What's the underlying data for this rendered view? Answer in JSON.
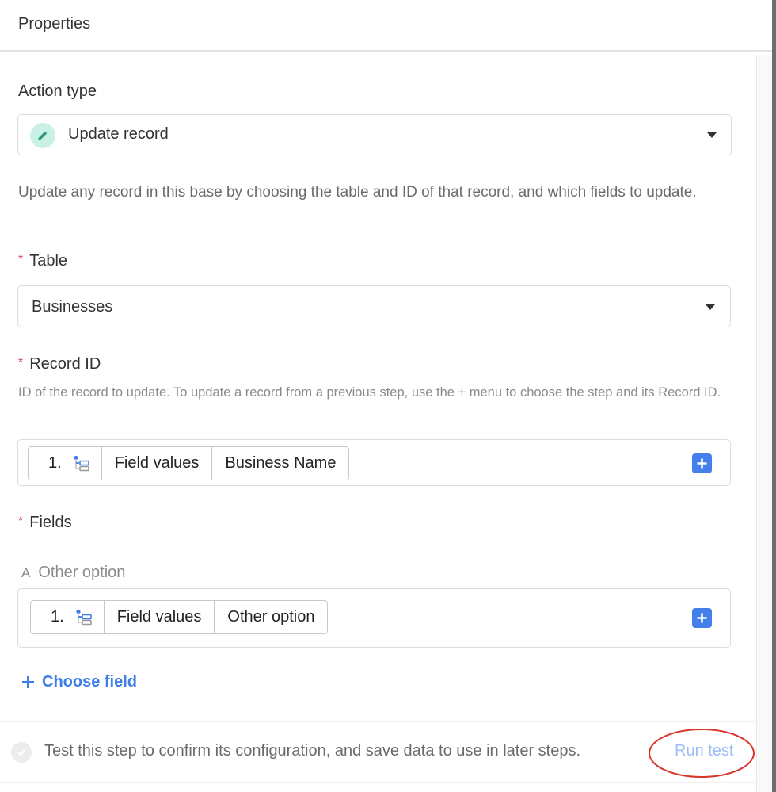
{
  "header": {
    "title": "Properties"
  },
  "action_type": {
    "label": "Action type",
    "selected": "Update record",
    "icon": "pencil-icon",
    "icon_bg_color": "#c9f1e4",
    "icon_color": "#2c9a86",
    "description": "Update any record in this base by choosing the table and ID of that record, and which fields to update."
  },
  "table": {
    "label": "Table",
    "required_marker": "*",
    "selected": "Businesses"
  },
  "record_id": {
    "label": "Record ID",
    "required_marker": "*",
    "hint": "ID of the record to update. To update a record from a previous step, use the + menu to choose the step and its Record ID.",
    "token": {
      "step": "1.",
      "step_icon": "trigger-step-icon",
      "source": "Field values",
      "field": "Business Name"
    }
  },
  "fields": {
    "label": "Fields",
    "required_marker": "*",
    "items": [
      {
        "type_glyph": "A",
        "name": "Other option",
        "token": {
          "step": "1.",
          "step_icon": "trigger-step-icon",
          "source": "Field values",
          "field": "Other option"
        }
      }
    ],
    "choose_field_label": "Choose field"
  },
  "test": {
    "message": "Test this step to confirm its configuration, and save data to use in later steps.",
    "run_label": "Run test"
  },
  "colors": {
    "accent_blue": "#4480ec",
    "link_blue": "#3d7ee6",
    "run_test_blue": "#9cbcf4",
    "required_red": "#e03e5c",
    "annotation_red": "#d9352a"
  }
}
